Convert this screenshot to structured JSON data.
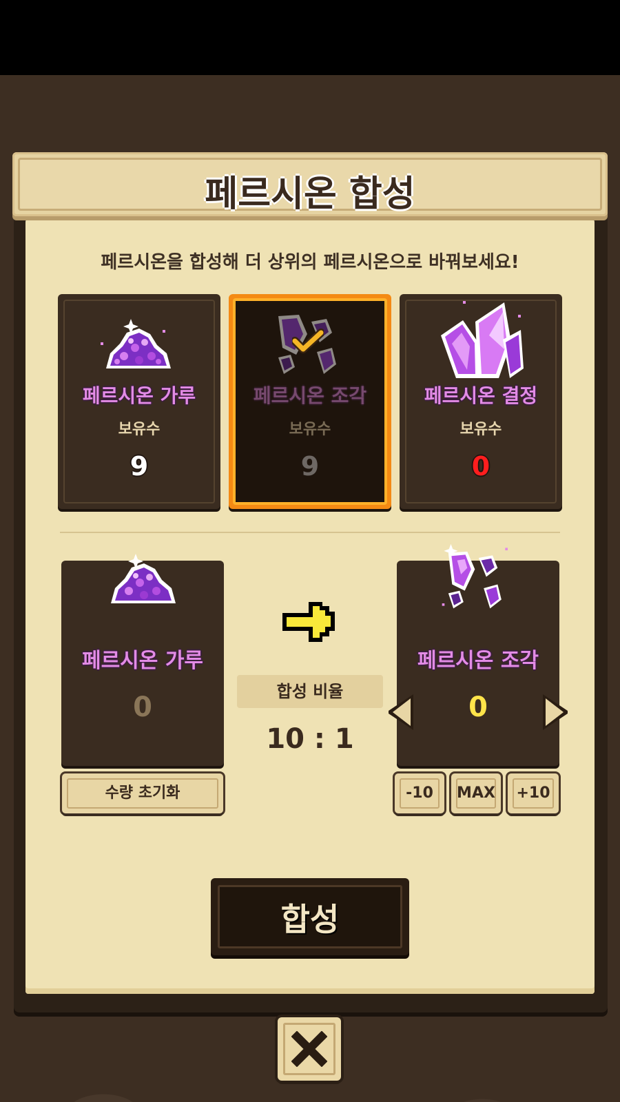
{
  "title": "페르시온 합성",
  "subtitle": "페르시온을 합성해 더 상위의 페르시온으로 바꿔보세요!",
  "materials": [
    {
      "name": "페르시온 가루",
      "owned_label": "보유수",
      "count": "9",
      "icon": "persion-powder-icon",
      "selected": false
    },
    {
      "name": "페르시온 조각",
      "owned_label": "보유수",
      "count": "9",
      "icon": "persion-fragment-icon",
      "selected": true
    },
    {
      "name": "페르시온 결정",
      "owned_label": "보유수",
      "count": "0",
      "icon": "persion-crystal-icon",
      "selected": false
    }
  ],
  "synthesis": {
    "source": {
      "name": "페르시온 가루",
      "quantity": "0",
      "icon": "persion-powder-icon"
    },
    "target": {
      "name": "페르시온 조각",
      "quantity": "0",
      "icon": "persion-fragment-icon"
    },
    "ratio_label": "합성 비율",
    "ratio_value": "10 : 1",
    "reset_label": "수량 초기화",
    "minus_label": "-10",
    "max_label": "MAX",
    "plus_label": "+10",
    "synth_label": "합성"
  },
  "colors": {
    "item_name": "#e38be6",
    "selected_border": "#f48a14",
    "zero_count": "#ff1e1e",
    "target_qty": "#ffe44a"
  }
}
